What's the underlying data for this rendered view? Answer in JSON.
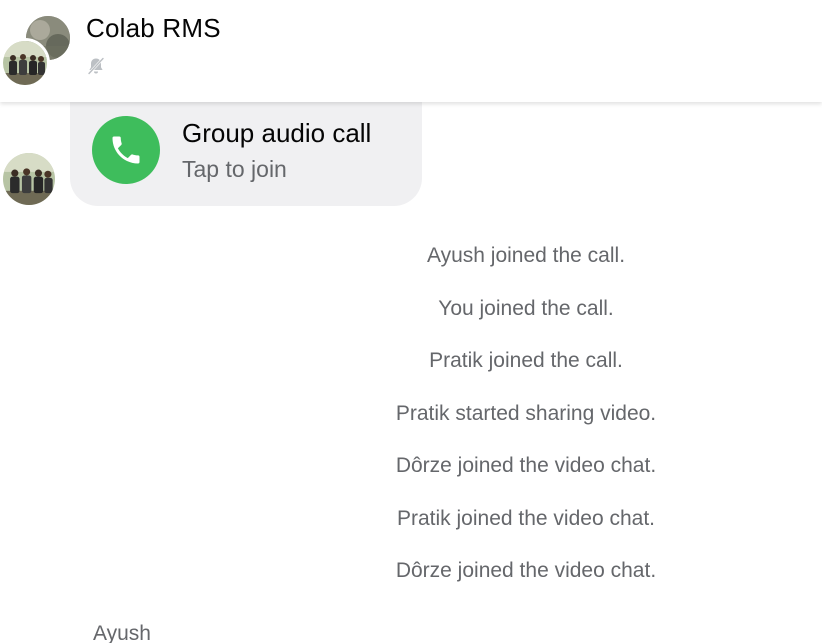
{
  "header": {
    "title": "Colab RMS",
    "status_icon": "muted-bell-icon"
  },
  "call_card": {
    "title": "Group audio call",
    "subtitle": "Tap to join",
    "icon": "phone-icon",
    "accent_color": "#3ebd5c"
  },
  "events": [
    "Ayush joined the call.",
    "You joined the call.",
    "Pratik joined the call.",
    "Pratik started sharing video.",
    "Dôrze joined the video chat.",
    "Pratik joined the video chat.",
    "Dôrze joined the video chat."
  ],
  "next_message": {
    "sender": "Ayush"
  }
}
